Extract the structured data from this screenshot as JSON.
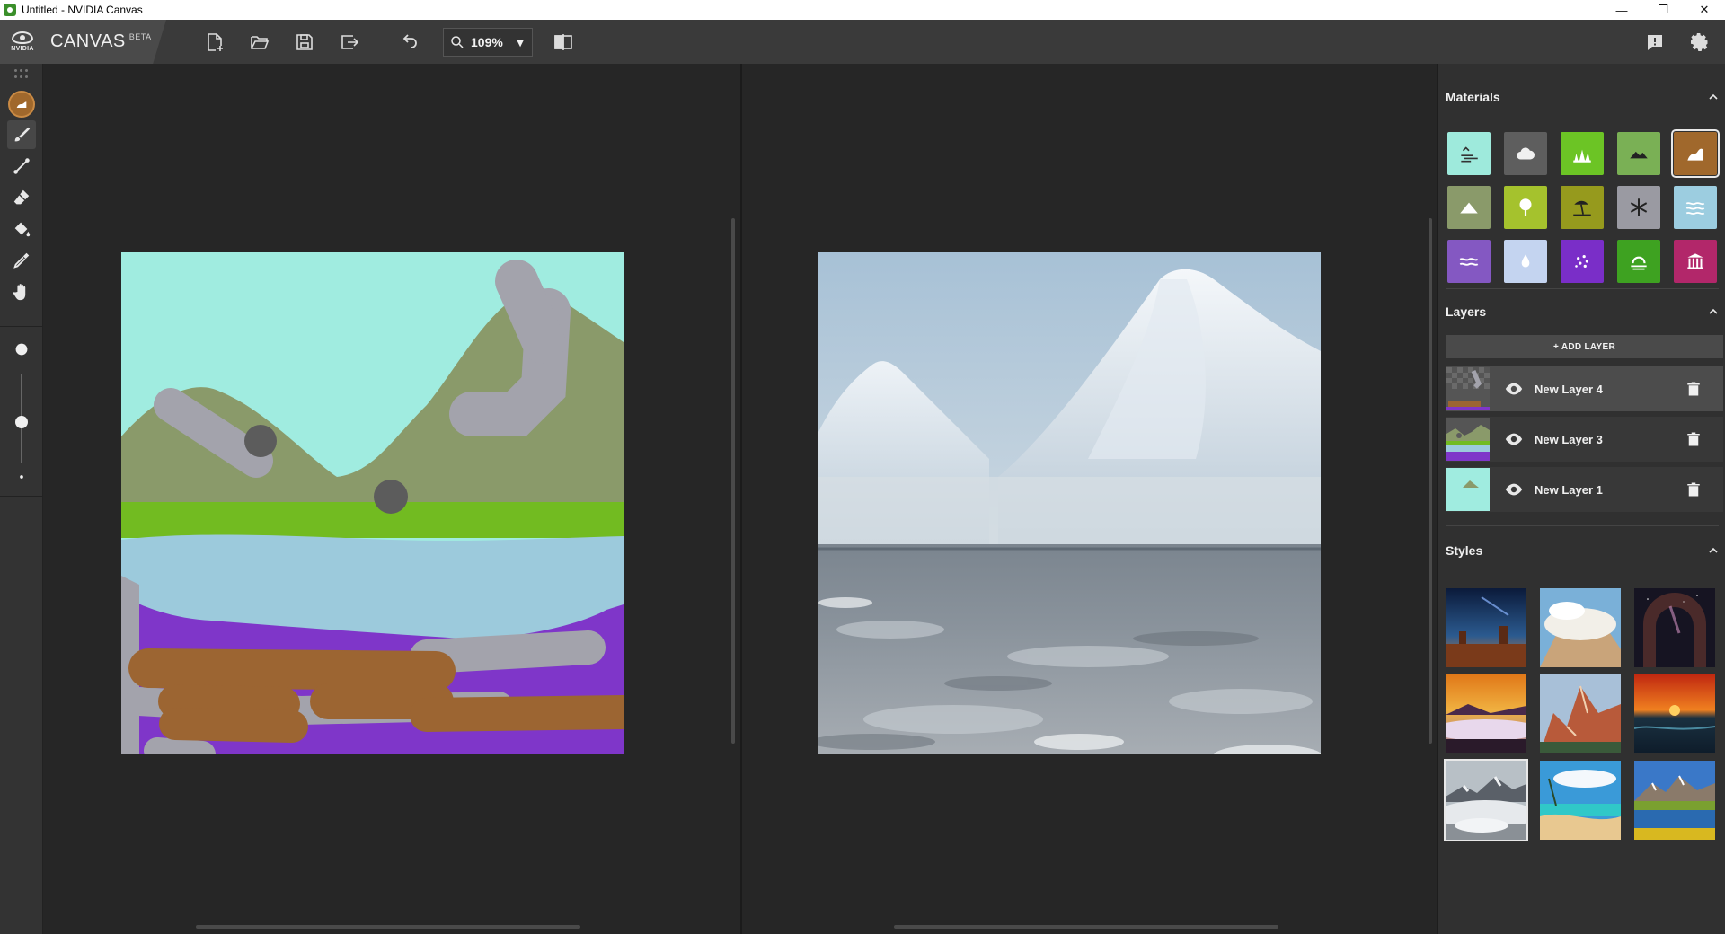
{
  "window": {
    "title": "Untitled - NVIDIA Canvas",
    "minimize": "—",
    "maximize": "❐",
    "close": "✕"
  },
  "brand": {
    "logo_text": "NVIDIA",
    "name": "CANVAS",
    "badge": "BETA"
  },
  "toolbar": {
    "zoom_value": "109%",
    "buttons": [
      "new-file",
      "open-folder",
      "save",
      "export",
      "undo",
      "zoom",
      "compare-view",
      "feedback",
      "settings"
    ]
  },
  "tools": {
    "active": "brush",
    "selected_material_color": "#a0682c",
    "items": [
      "material-picker",
      "brush",
      "line",
      "eraser",
      "fill-bucket",
      "eyedropper",
      "pan-hand"
    ],
    "brush_size_levels": [
      "large",
      "medium",
      "small"
    ]
  },
  "materials": {
    "title": "Materials",
    "selected": "dirt",
    "items": [
      {
        "name": "sky",
        "color": "#9eeadc"
      },
      {
        "name": "cloud",
        "color": "#5e5e5e"
      },
      {
        "name": "grass",
        "color": "#6cc425"
      },
      {
        "name": "mountain",
        "color": "#7ab055"
      },
      {
        "name": "dirt",
        "color": "#a0682c"
      },
      {
        "name": "hill",
        "color": "#8a9a6a"
      },
      {
        "name": "tree",
        "color": "#a5c22d"
      },
      {
        "name": "beach",
        "color": "#969a1d"
      },
      {
        "name": "snow",
        "color": "#9a9aa2"
      },
      {
        "name": "river",
        "color": "#9ccde0"
      },
      {
        "name": "sea",
        "color": "#8458c2"
      },
      {
        "name": "water",
        "color": "#c4d4f0"
      },
      {
        "name": "flowers",
        "color": "#7a2ec8"
      },
      {
        "name": "fog",
        "color": "#3ea221"
      },
      {
        "name": "building",
        "color": "#b2276a"
      }
    ]
  },
  "layers": {
    "title": "Layers",
    "add_label": "+ ADD LAYER",
    "items": [
      {
        "name": "New Layer 4",
        "selected": true
      },
      {
        "name": "New Layer 3",
        "selected": false
      },
      {
        "name": "New Layer 1",
        "selected": false
      }
    ]
  },
  "styles": {
    "title": "Styles",
    "selected_index": 6,
    "items": [
      "desert-night",
      "cloudy-peak",
      "stone-arch",
      "sunset-fog",
      "red-peaks",
      "ocean-sunset",
      "misty-mountains",
      "tropical-beach",
      "alpine-lake"
    ]
  }
}
